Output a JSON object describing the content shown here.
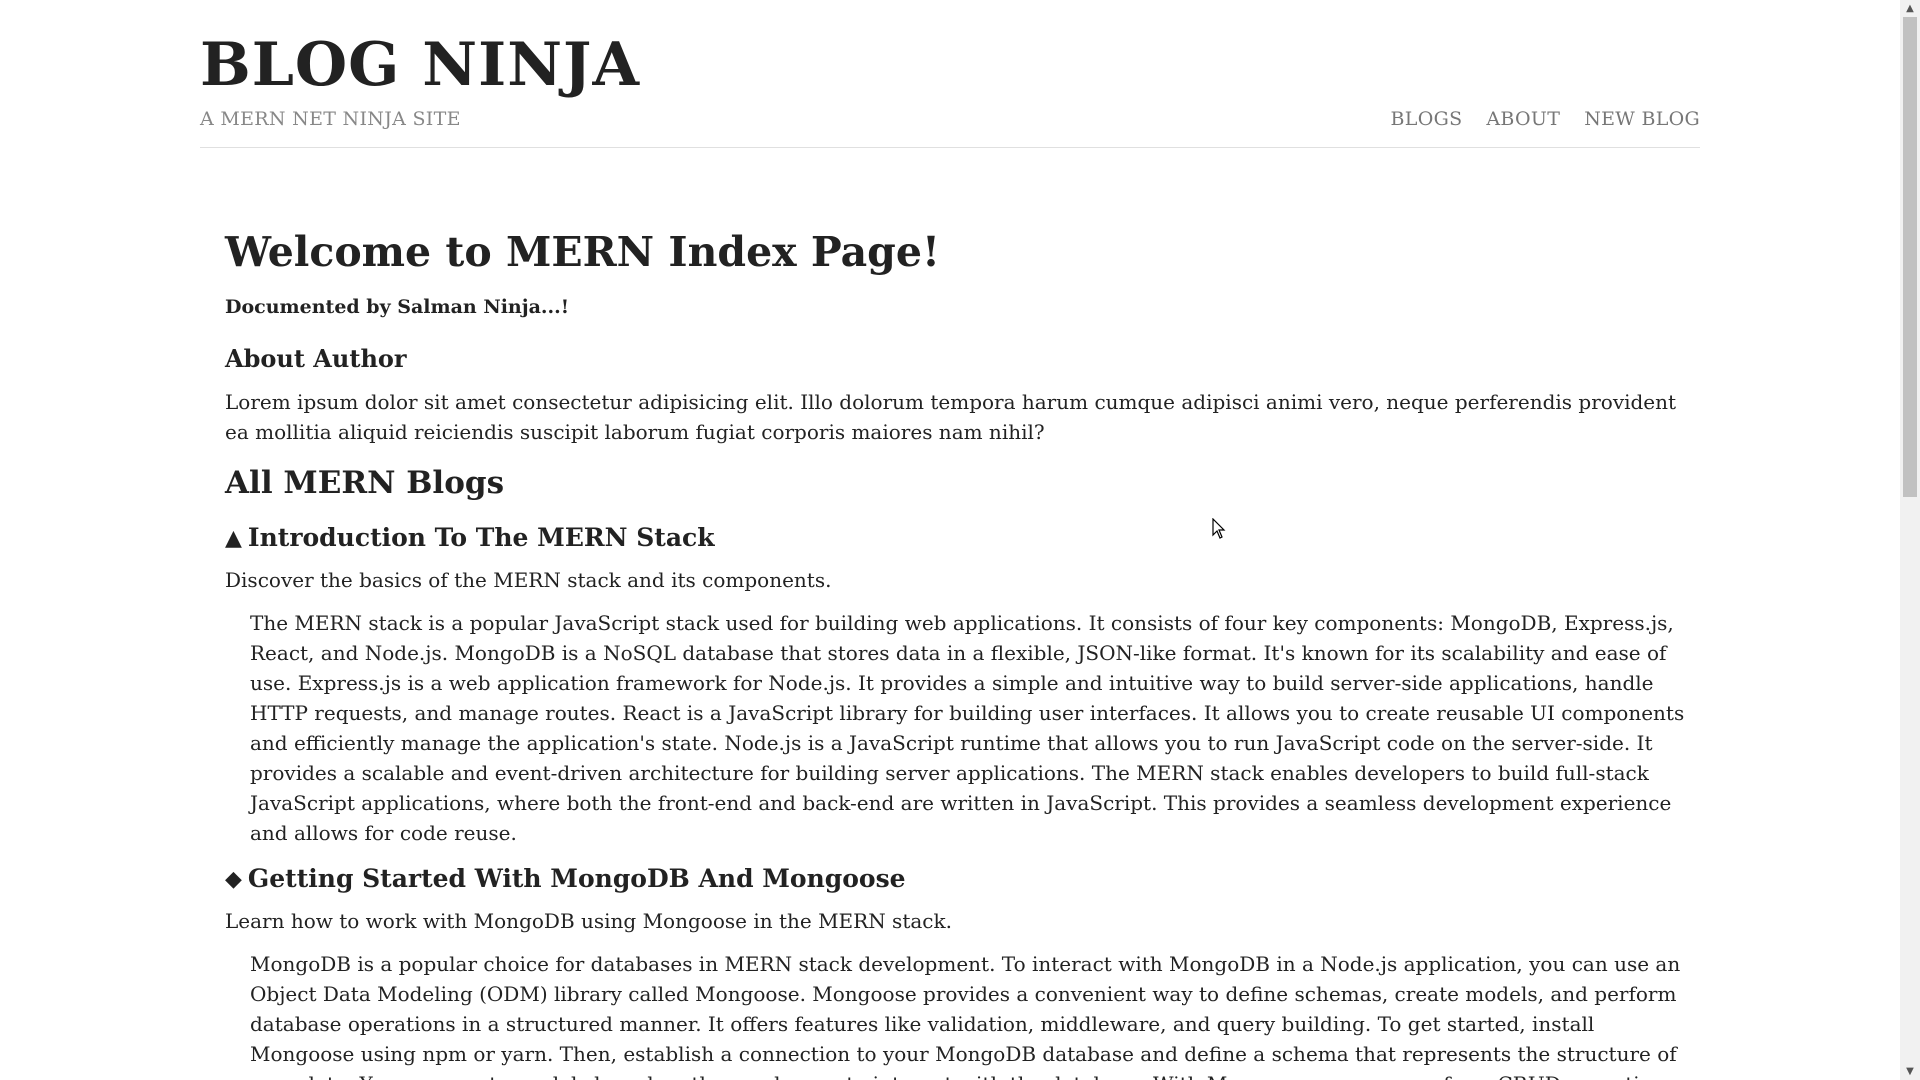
{
  "header": {
    "site_title": "BLOG NINJA",
    "site_subtitle": "A MERN NET NINJA SITE",
    "nav": [
      {
        "label": "BLOGS"
      },
      {
        "label": "ABOUT"
      },
      {
        "label": "NEW BLOG"
      }
    ]
  },
  "main": {
    "welcome_heading": "Welcome to MERN Index Page!",
    "documented_by": "Documented by Salman Ninja...!",
    "about_title": "About Author",
    "about_text": "Lorem ipsum dolor sit amet consectetur adipisicing elit. Illo dolorum tempora harum cumque adipisci animi vero, neque perferendis provident ea mollitia aliquid reiciendis suscipit laborum fugiat corporis maiores nam nihil?",
    "blogs_title": "All MERN Blogs",
    "blogs": [
      {
        "marker": "▲",
        "title": "Introduction To The MERN Stack",
        "snippet": "Discover the basics of the MERN stack and its components.",
        "body": "The MERN stack is a popular JavaScript stack used for building web applications. It consists of four key components: MongoDB, Express.js, React, and Node.js. MongoDB is a NoSQL database that stores data in a flexible, JSON-like format. It's known for its scalability and ease of use. Express.js is a web application framework for Node.js. It provides a simple and intuitive way to build server-side applications, handle HTTP requests, and manage routes. React is a JavaScript library for building user interfaces. It allows you to create reusable UI components and efficiently manage the application's state. Node.js is a JavaScript runtime that allows you to run JavaScript code on the server-side. It provides a scalable and event-driven architecture for building server applications. The MERN stack enables developers to build full-stack JavaScript applications, where both the front-end and back-end are written in JavaScript. This provides a seamless development experience and allows for code reuse."
      },
      {
        "marker": "◆",
        "title": "Getting Started With MongoDB And Mongoose",
        "snippet": "Learn how to work with MongoDB using Mongoose in the MERN stack.",
        "body": "MongoDB is a popular choice for databases in MERN stack development. To interact with MongoDB in a Node.js application, you can use an Object Data Modeling (ODM) library called Mongoose. Mongoose provides a convenient way to define schemas, create models, and perform database operations in a structured manner. It offers features like validation, middleware, and query building. To get started, install Mongoose using npm or yarn. Then, establish a connection to your MongoDB database and define a schema that represents the structure of your data. You can create models based on these schemas to interact with the database. With Mongoose, you can perform CRUD operations (Create, Read, Update, Delete), execute complex queries, and"
      }
    ]
  },
  "scrollbar": {
    "up_icon": "chevron-up-icon",
    "down_icon": "chevron-down-icon"
  }
}
